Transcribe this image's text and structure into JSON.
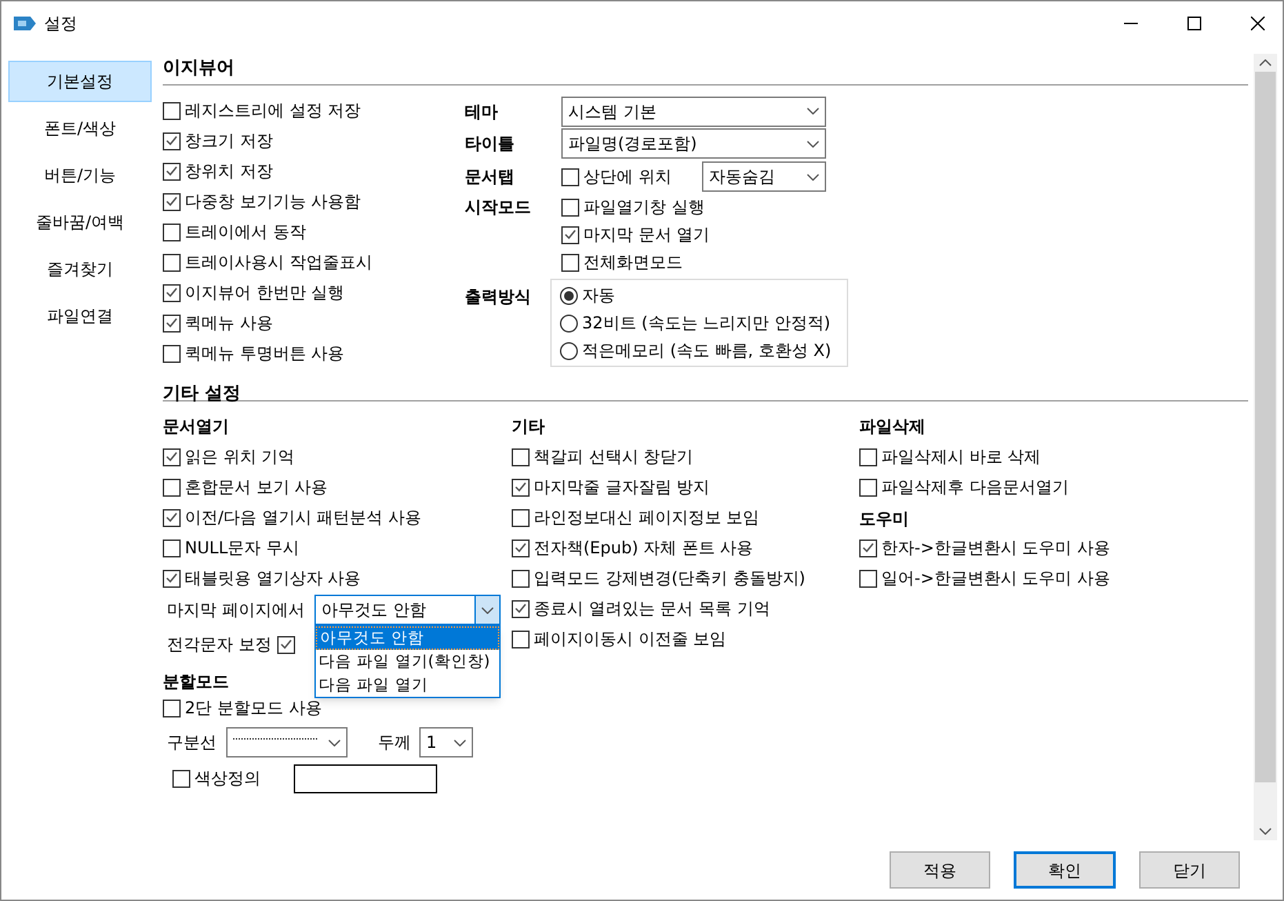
{
  "window": {
    "title": "설정"
  },
  "sidebar": {
    "items": [
      {
        "label": "기본설정",
        "selected": true
      },
      {
        "label": "폰트/색상",
        "selected": false
      },
      {
        "label": "버튼/기능",
        "selected": false
      },
      {
        "label": "줄바꿈/여백",
        "selected": false
      },
      {
        "label": "즐겨찾기",
        "selected": false
      },
      {
        "label": "파일연결",
        "selected": false
      }
    ]
  },
  "easyviewer": {
    "title": "이지뷰어",
    "options": [
      {
        "label": "레지스트리에 설정 저장",
        "checked": false
      },
      {
        "label": "창크기 저장",
        "checked": true
      },
      {
        "label": "창위치 저장",
        "checked": true
      },
      {
        "label": "다중창 보기기능 사용함",
        "checked": true
      },
      {
        "label": "트레이에서 동작",
        "checked": false
      },
      {
        "label": "트레이사용시 작업줄표시",
        "checked": false
      },
      {
        "label": "이지뷰어 한번만 실행",
        "checked": true
      },
      {
        "label": "퀵메뉴 사용",
        "checked": true
      },
      {
        "label": "퀵메뉴 투명버튼 사용",
        "checked": false
      }
    ],
    "theme": {
      "label": "테마",
      "value": "시스템 기본"
    },
    "title_setting": {
      "label": "타이틀",
      "value": "파일명(경로포함)"
    },
    "doc_tab": {
      "label": "문서탭",
      "checkbox": {
        "label": "상단에 위치",
        "checked": false
      },
      "value": "자동숨김"
    },
    "start_mode": {
      "label": "시작모드",
      "options": [
        {
          "label": "파일열기창 실행",
          "checked": false
        },
        {
          "label": "마지막 문서 열기",
          "checked": true
        },
        {
          "label": "전체화면모드",
          "checked": false
        }
      ]
    },
    "output": {
      "label": "출력방식",
      "options": [
        {
          "label": "자동",
          "selected": true
        },
        {
          "label": "32비트 (속도는 느리지만 안정적)",
          "selected": false
        },
        {
          "label": "적은메모리 (속도 빠름, 호환성 X)",
          "selected": false
        }
      ]
    }
  },
  "other": {
    "title": "기타 설정",
    "doc_open": {
      "title": "문서열기",
      "options": [
        {
          "label": "읽은 위치 기억",
          "checked": true
        },
        {
          "label": "혼합문서 보기 사용",
          "checked": false
        },
        {
          "label": "이전/다음 열기시 패턴분석 사용",
          "checked": true
        },
        {
          "label": "NULL문자 무시",
          "checked": false
        },
        {
          "label": "태블릿용 열기상자 사용",
          "checked": true
        }
      ],
      "last_page": {
        "label": "마지막 페이지에서",
        "value": "아무것도 안함",
        "expanded": true,
        "options": [
          {
            "label": "아무것도 안함",
            "selected": true
          },
          {
            "label": "다음 파일 열기(확인창)",
            "selected": false
          },
          {
            "label": "다음 파일 열기",
            "selected": false
          }
        ]
      },
      "fullwidth": {
        "label": "전각문자 보정",
        "checked": true
      }
    },
    "split_mode": {
      "title": "분할모드",
      "option": {
        "label": "2단 분할모드 사용",
        "checked": false
      },
      "divider": {
        "label": "구분선"
      },
      "thickness": {
        "label": "두께",
        "value": "1"
      },
      "custom_color": {
        "label": "색상정의",
        "checked": false
      }
    },
    "misc": {
      "title": "기타",
      "options": [
        {
          "label": "책갈피 선택시 창닫기",
          "checked": false
        },
        {
          "label": "마지막줄 글자잘림 방지",
          "checked": true
        },
        {
          "label": "라인정보대신 페이지정보 보임",
          "checked": false
        },
        {
          "label": "전자책(Epub) 자체 폰트 사용",
          "checked": true
        },
        {
          "label": "입력모드 강제변경(단축키 충돌방지)",
          "checked": false
        },
        {
          "label": "종료시 열려있는 문서 목록 기억",
          "checked": true
        },
        {
          "label": "페이지이동시 이전줄 보임",
          "checked": false
        }
      ]
    },
    "file_delete": {
      "title": "파일삭제",
      "options": [
        {
          "label": "파일삭제시 바로 삭제",
          "checked": false
        },
        {
          "label": "파일삭제후 다음문서열기",
          "checked": false
        }
      ]
    },
    "helper": {
      "title": "도우미",
      "options": [
        {
          "label": "한자->한글변환시 도우미 사용",
          "checked": true
        },
        {
          "label": "일어->한글변환시 도우미 사용",
          "checked": false
        }
      ]
    }
  },
  "buttons": [
    {
      "label": "적용",
      "kind": "normal"
    },
    {
      "label": "확인",
      "kind": "default"
    },
    {
      "label": "닫기",
      "kind": "normal"
    }
  ]
}
